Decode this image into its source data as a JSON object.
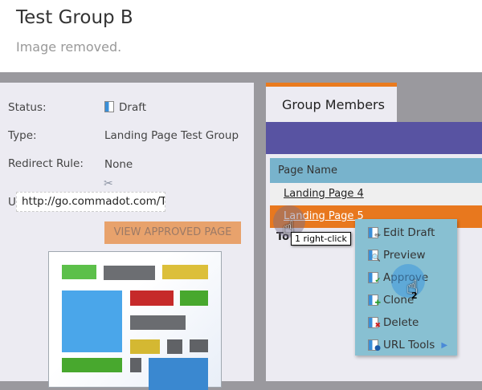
{
  "header": {
    "title": "Test Group B",
    "subtitle": "Image removed."
  },
  "details": {
    "status_label": "Status:",
    "status_value": "Draft",
    "type_label": "Type:",
    "type_value": "Landing Page Test Group",
    "redirect_label": "Redirect Rule:",
    "redirect_value": "None",
    "url_label": "U",
    "url_value": "http://go.commadot.com/T",
    "view_button": "VIEW APPROVED PAGE"
  },
  "tabs": [
    {
      "label": "Group Members",
      "active": true
    }
  ],
  "table": {
    "columns": [
      "Page Name"
    ],
    "rows": [
      "Landing Page 4",
      "Landing Page 5"
    ],
    "selected_row": 1,
    "footer_partial": "To"
  },
  "context_menu": {
    "items": [
      {
        "label": "Edit Draft",
        "icon": "edit-icon"
      },
      {
        "label": "Preview",
        "icon": "preview-icon"
      },
      {
        "label": "Approve",
        "icon": "approve-icon"
      },
      {
        "label": "Clone",
        "icon": "clone-icon"
      },
      {
        "label": "Delete",
        "icon": "delete-icon"
      },
      {
        "label": "URL Tools",
        "icon": "info-icon",
        "submenu": true
      }
    ]
  },
  "annotations": [
    {
      "step": "1",
      "text": "right-click"
    },
    {
      "step": "2",
      "text": ""
    }
  ],
  "colors": {
    "accent_orange": "#e8781e",
    "purple_bar": "#5853a2",
    "table_header": "#78b3cc",
    "menu_bg": "#88c0d2"
  }
}
